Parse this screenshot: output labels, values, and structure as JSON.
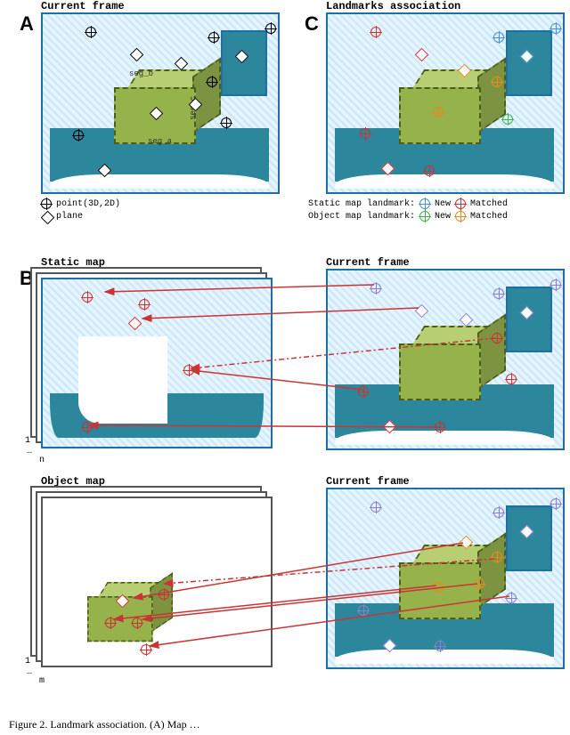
{
  "labels": {
    "A": "A",
    "B": "B",
    "C": "C",
    "panel_a_title": "Current frame",
    "panel_c_title": "Landmarks association",
    "static_map_title": "Static map",
    "object_map_title": "Object map",
    "current_frame_title_b1": "Current frame",
    "current_frame_title_b2": "Current frame",
    "seg_a": "seg_a",
    "seg_b": "seg_b",
    "seg_c": "seg_c",
    "index_1a": "1",
    "index_na": "n",
    "dots_a": "…",
    "index_1b": "1",
    "index_mb": "m",
    "dots_b": "…"
  },
  "legend_a": {
    "point": "point(3D,2D)",
    "plane": "plane"
  },
  "legend_c": {
    "row1_label": "Static map landmark:",
    "row1_new": "New",
    "row1_match": "Matched",
    "row2_label": "Object map landmark:",
    "row2_new": "New",
    "row2_match": "Matched"
  },
  "caption": "Figure 2. Landmark association. (A) Map …"
}
